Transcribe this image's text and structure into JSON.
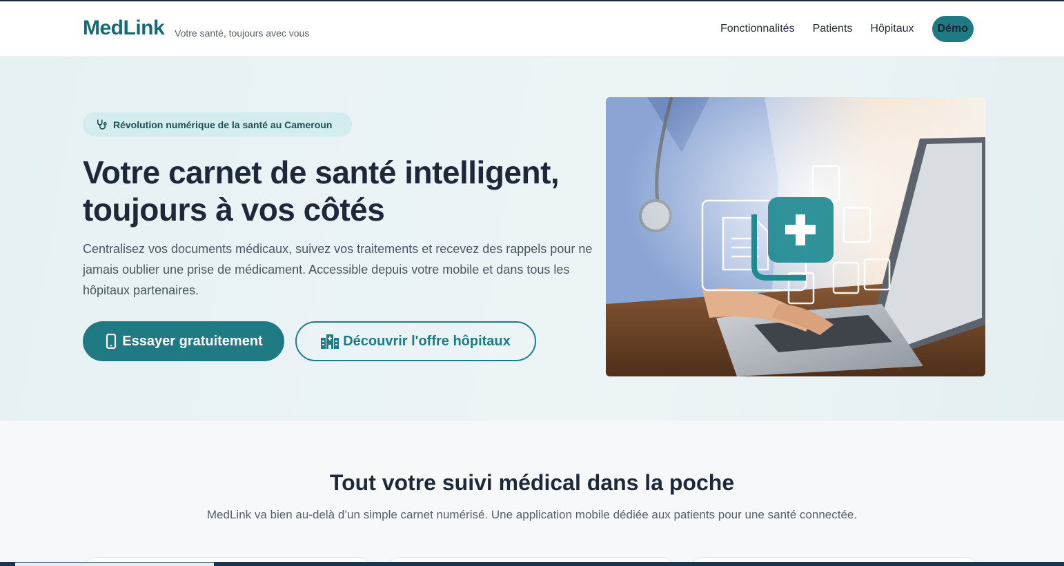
{
  "header": {
    "brand": "MedLink",
    "tagline": "Votre santé, toujours avec vous",
    "nav": [
      {
        "label": "Fonctionnalités"
      },
      {
        "label": "Patients"
      },
      {
        "label": "Hôpitaux"
      }
    ],
    "demo_label": "Démo"
  },
  "hero": {
    "badge_text": "Révolution numérique de la santé au Cameroun",
    "badge_icon": "stethoscope-icon",
    "title_line1": "Votre carnet de santé intelligent,",
    "title_line2": "toujours à vos côtés",
    "description": "Centralisez vos documents médicaux, suivez vos traitements et recevez des rappels pour ne jamais oublier une prise de médicament. Accessible depuis votre mobile et dans tous les hôpitaux partenaires.",
    "primary_button": {
      "label": "Essayer gratuitement",
      "icon": "mobile-phone-icon"
    },
    "secondary_button": {
      "label": "Découvrir l'offre hôpitaux",
      "icon": "hospital-icon"
    },
    "image_icon": "medical-records-laptop-image"
  },
  "features": {
    "title": "Tout votre suivi médical dans la poche",
    "subtitle": "MedLink va bien au-delà d’un simple carnet numérisé. Une application mobile dédiée aux patients pour une santé connectée."
  },
  "colors": {
    "brand": "#176a73",
    "accent": "#1f7a83",
    "badge_bg": "#d3ecee",
    "text_dark": "#1d2939"
  }
}
